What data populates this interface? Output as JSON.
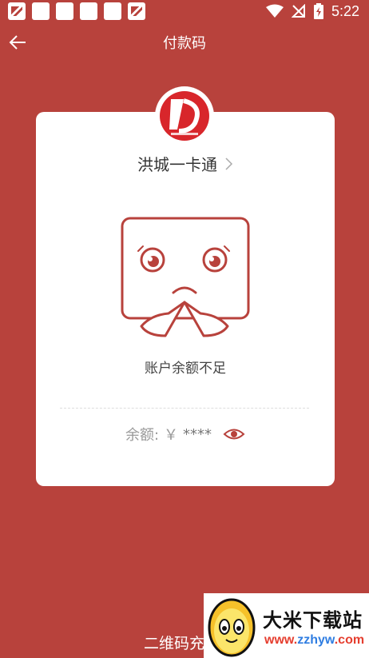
{
  "status_bar": {
    "time": "5:22",
    "notification_icons": [
      "app-logo-notif",
      "blank",
      "blank",
      "blank",
      "blank",
      "app-logo-notif"
    ]
  },
  "nav": {
    "title": "付款码"
  },
  "card": {
    "name": "洪城一卡通",
    "empty_message": "账户余额不足",
    "balance_label": "余额:",
    "balance_currency": "￥",
    "balance_value": "****"
  },
  "bottom": {
    "link_text": "二维码充"
  },
  "watermark": {
    "brand": "大米下载站",
    "url_part1": "www.",
    "url_part2": "zzhyw",
    "url_part3": ".com"
  },
  "colors": {
    "background": "#b8423c",
    "logo_red": "#d8262b",
    "card": "#ffffff"
  }
}
